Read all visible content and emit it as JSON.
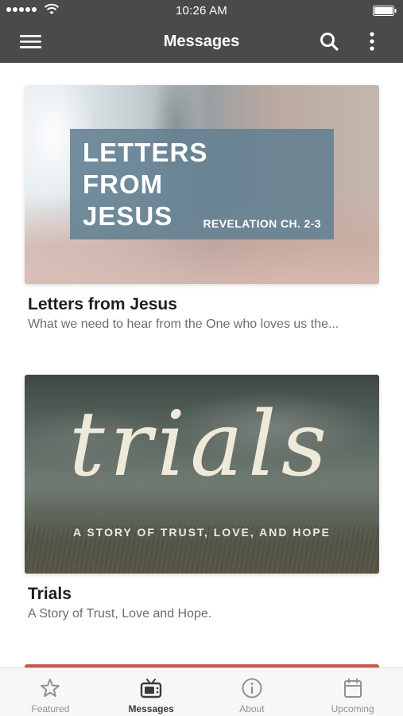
{
  "status_bar": {
    "time": "10:26 AM"
  },
  "nav": {
    "title": "Messages",
    "menu_icon": "hamburger-menu-icon",
    "search_icon": "search-icon",
    "more_icon": "more-vertical-icon"
  },
  "cards": [
    {
      "title": "Letters from Jesus",
      "subtitle": "What we need to hear from the One who loves us the...",
      "art_title": "LETTERS FROM JESUS",
      "art_ref": "REVELATION CH. 2-3"
    },
    {
      "title": "Trials",
      "subtitle": "A Story of Trust, Love and Hope.",
      "art_script": "trials",
      "art_tag": "A STORY OF TRUST, LOVE, AND HOPE"
    }
  ],
  "tabs": [
    {
      "label": "Featured",
      "icon": "star-icon",
      "active": false
    },
    {
      "label": "Messages",
      "icon": "tv-icon",
      "active": true
    },
    {
      "label": "About",
      "icon": "info-icon",
      "active": false
    },
    {
      "label": "Upcoming",
      "icon": "calendar-icon",
      "active": false
    }
  ],
  "colors": {
    "header": "#4a4a48",
    "tab_active": "#3b3b3b",
    "tab_inactive": "#929292"
  }
}
